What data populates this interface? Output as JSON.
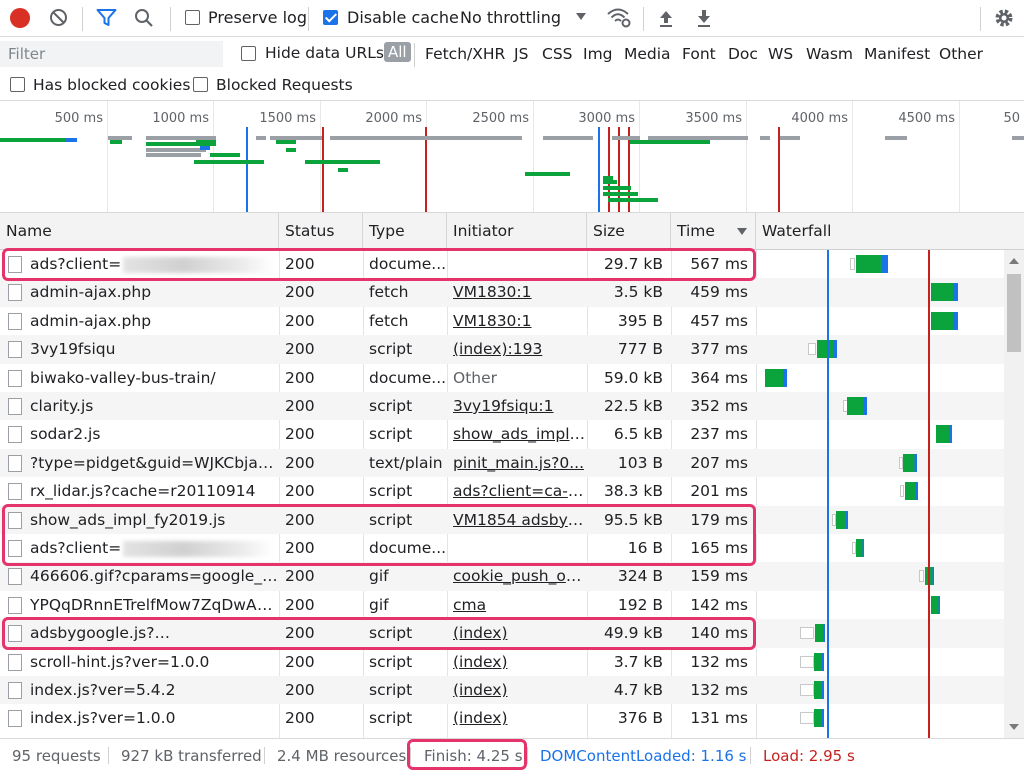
{
  "toolbar": {
    "preserve_log": "Preserve log",
    "disable_cache": "Disable cache",
    "throttling": "No throttling",
    "icons": [
      "record-stop-icon",
      "clear-icon",
      "filter-icon",
      "search-icon",
      "wifi-settings-icon",
      "upload-icon",
      "download-icon",
      "gear-icon"
    ]
  },
  "filterbar": {
    "placeholder": "Filter",
    "hide_data_urls": "Hide data URLs",
    "types": [
      "All",
      "Fetch/XHR",
      "JS",
      "CSS",
      "Img",
      "Media",
      "Font",
      "Doc",
      "WS",
      "Wasm",
      "Manifest",
      "Other"
    ],
    "has_blocked_cookies": "Has blocked cookies",
    "blocked_requests": "Blocked Requests"
  },
  "overview": {
    "ticks": [
      "500 ms",
      "1000 ms",
      "1500 ms",
      "2000 ms",
      "2500 ms",
      "3000 ms",
      "3500 ms",
      "4000 ms",
      "4500 ms",
      "50"
    ]
  },
  "columns": [
    "Name",
    "Status",
    "Type",
    "Initiator",
    "Size",
    "Time",
    "Waterfall"
  ],
  "requests": [
    {
      "name": "ads?client=",
      "status": "200",
      "type": "docume...",
      "initiator": "",
      "size": "29.7 kB",
      "time": "567 ms",
      "blur": true
    },
    {
      "name": "admin-ajax.php",
      "status": "200",
      "type": "fetch",
      "initiator": "VM1830:1",
      "size": "3.5 kB",
      "time": "459 ms"
    },
    {
      "name": "admin-ajax.php",
      "status": "200",
      "type": "fetch",
      "initiator": "VM1830:1",
      "size": "395 B",
      "time": "457 ms"
    },
    {
      "name": "3vy19fsiqu",
      "status": "200",
      "type": "script",
      "initiator": "(index):193",
      "size": "777 B",
      "time": "377 ms"
    },
    {
      "name": "biwako-valley-bus-train/",
      "status": "200",
      "type": "docume...",
      "initiator": "Other",
      "size": "59.0 kB",
      "time": "364 ms"
    },
    {
      "name": "clarity.js",
      "status": "200",
      "type": "script",
      "initiator": "3vy19fsiqu:1",
      "size": "22.5 kB",
      "time": "352 ms"
    },
    {
      "name": "sodar2.js",
      "status": "200",
      "type": "script",
      "initiator": "show_ads_impl_...",
      "size": "6.5 kB",
      "time": "237 ms"
    },
    {
      "name": "?type=pidget&guid=WJKCbjaye...",
      "status": "200",
      "type": "text/plain",
      "initiator": "pinit_main.js?0...",
      "size": "103 B",
      "time": "207 ms"
    },
    {
      "name": "rx_lidar.js?cache=r20110914",
      "status": "200",
      "type": "script",
      "initiator": "ads?client=ca-p...",
      "size": "38.3 kB",
      "time": "201 ms"
    },
    {
      "name": "show_ads_impl_fy2019.js",
      "status": "200",
      "type": "script",
      "initiator": "VM1854 adsbyg...",
      "size": "95.5 kB",
      "time": "179 ms"
    },
    {
      "name": "ads?client=",
      "status": "200",
      "type": "docume...",
      "initiator": "",
      "size": "16 B",
      "time": "165 ms",
      "blur": true
    },
    {
      "name": "466606.gif?cparams=google_pu...",
      "status": "200",
      "type": "gif",
      "initiator": "cookie_push_on...",
      "size": "324 B",
      "time": "159 ms"
    },
    {
      "name": "YPQqDRnnETrelfMow7ZqDwAA...",
      "status": "200",
      "type": "gif",
      "initiator": "cma",
      "size": "192 B",
      "time": "142 ms"
    },
    {
      "name": "adsbygoogle.js?",
      "status": "200",
      "type": "script",
      "initiator": "(index)",
      "size": "49.9 kB",
      "time": "140 ms",
      "blur": true
    },
    {
      "name": "scroll-hint.js?ver=1.0.0",
      "status": "200",
      "type": "script",
      "initiator": "(index)",
      "size": "3.7 kB",
      "time": "132 ms"
    },
    {
      "name": "index.js?ver=5.4.2",
      "status": "200",
      "type": "script",
      "initiator": "(index)",
      "size": "4.7 kB",
      "time": "132 ms"
    },
    {
      "name": "index.js?ver=1.0.0",
      "status": "200",
      "type": "script",
      "initiator": "(index)",
      "size": "376 B",
      "time": "131 ms"
    }
  ],
  "status": {
    "requests": "95 requests",
    "transferred": "927 kB transferred",
    "resources": "2.4 MB resources",
    "finish": "Finish: 4.25 s",
    "dom_content_loaded": "DOMContentLoaded: 1.16 s",
    "load": "Load: 2.95 s"
  },
  "colors": {
    "dcl_line": "#1a73e8",
    "load_line": "#c5221f",
    "wf_green": "#0aa33c",
    "wf_blue": "#1a73e8",
    "highlight": "#e5336b"
  }
}
